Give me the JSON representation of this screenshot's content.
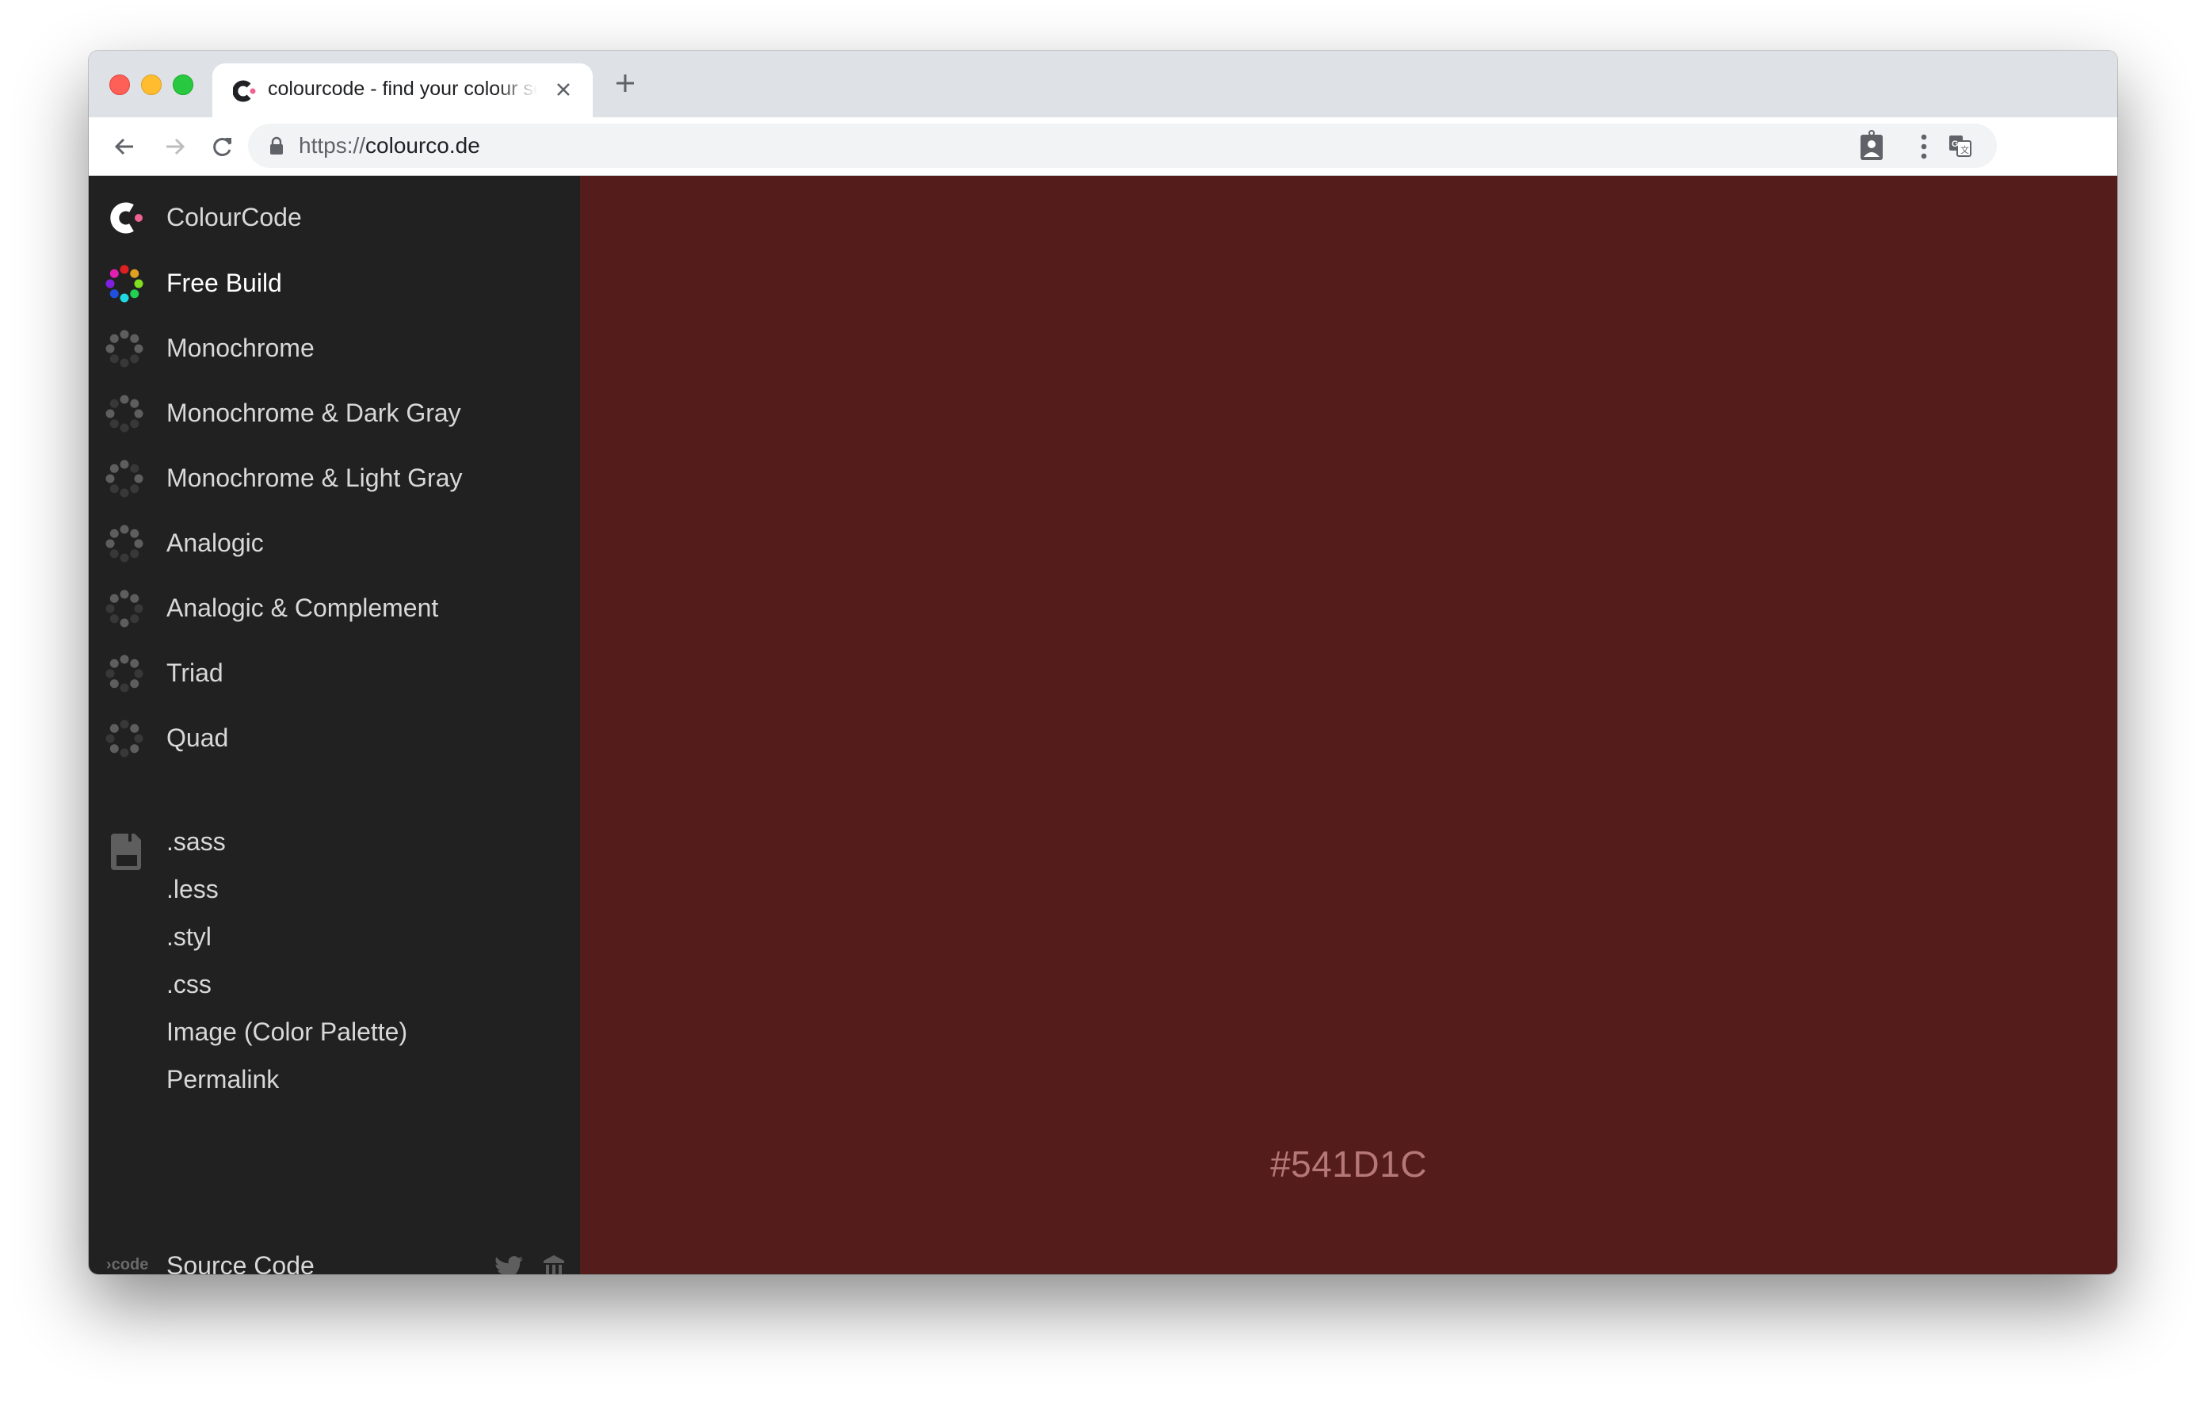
{
  "browser": {
    "tab_title": "colourcode - find your colour scheme",
    "url_scheme": "https://",
    "url_host": "colourco.de",
    "icons": [
      "back-arrow-icon",
      "forward-arrow-icon",
      "reload-icon",
      "lock-icon",
      "translate-icon",
      "profile-icon",
      "more-menu-icon",
      "close-icon",
      "plus-icon"
    ]
  },
  "sidebar": {
    "brand": "ColourCode",
    "modes": [
      {
        "label": "Free Build",
        "active": true
      },
      {
        "label": "Monochrome",
        "pattern": [
          1,
          1,
          1,
          0,
          0,
          0,
          1,
          1
        ]
      },
      {
        "label": "Monochrome & Dark Gray",
        "pattern": [
          1,
          1,
          1,
          0,
          0,
          0,
          1,
          0
        ]
      },
      {
        "label": "Monochrome & Light Gray",
        "pattern": [
          1,
          0,
          1,
          0,
          0,
          0,
          1,
          1
        ]
      },
      {
        "label": "Analogic",
        "pattern": [
          1,
          1,
          1,
          0,
          0,
          0,
          1,
          1
        ]
      },
      {
        "label": "Analogic & Complement",
        "pattern": [
          1,
          1,
          0,
          0,
          1,
          0,
          0,
          1
        ]
      },
      {
        "label": "Triad",
        "pattern": [
          1,
          1,
          0,
          1,
          0,
          1,
          0,
          1
        ]
      },
      {
        "label": "Quad",
        "pattern": [
          0,
          1,
          0,
          1,
          0,
          1,
          0,
          1
        ]
      }
    ],
    "export_links": [
      ".sass",
      ".less",
      ".styl",
      ".css",
      "Image (Color Palette)",
      "Permalink"
    ],
    "footer": {
      "code_logo": "›code",
      "source_label": "Source Code"
    }
  },
  "main": {
    "color_hex": "#541D1C",
    "background": "#541d1c"
  },
  "colors": {
    "free_build_dots": [
      "#e02020",
      "#e0a020",
      "#80e020",
      "#20d050",
      "#20d8e0",
      "#2050e0",
      "#8020e0",
      "#e020b0"
    ],
    "dot_light": "#5e5e5e",
    "dot_dark": "#383838",
    "brand_dot": "#f06292"
  }
}
